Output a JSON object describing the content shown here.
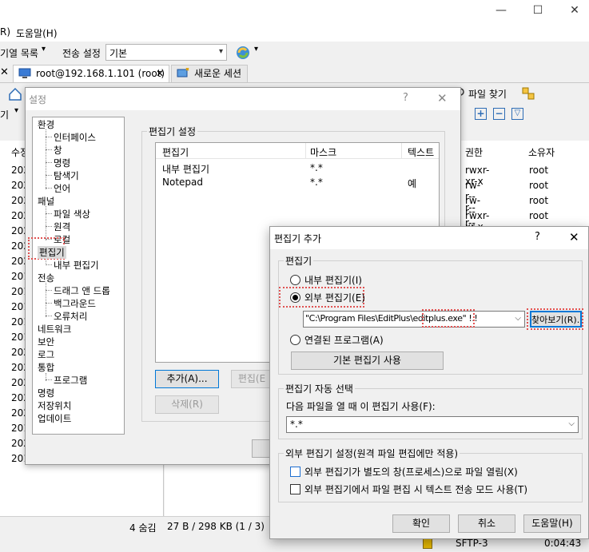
{
  "main_window": {
    "controls": {
      "minimize": "—",
      "maximize": "☐",
      "close": "✕"
    },
    "menu": {
      "partial_left": "R)",
      "help": "도움말(H)"
    },
    "toolbar": {
      "queue_dropdown": "기열 목록",
      "transfer_settings_label": "전송 설정",
      "transfer_settings_value": "기본"
    },
    "tabs": [
      {
        "label": "root@192.168.1.101 (root)",
        "close": "✕"
      },
      {
        "label": "새로운 세션"
      }
    ],
    "toolbar2": {
      "find_files": "파일 찾기",
      "partial_left": "기"
    },
    "right_columns": {
      "permissions": "권한",
      "owner": "소유자"
    },
    "left_column": {
      "modified_partial": "수정"
    },
    "files": [
      {
        "perm": "rwxr-xr-x",
        "owner": "root"
      },
      {
        "perm": "rw-r--r--",
        "owner": "root"
      },
      {
        "perm": "rw-r--r--",
        "owner": "root"
      },
      {
        "perm": "rwxr-xr-x",
        "owner": "root"
      }
    ],
    "left_dates": [
      "202",
      "202",
      "202",
      "202",
      "202",
      "202",
      "202",
      "201",
      "201",
      "201",
      "201",
      "201",
      "202",
      "202",
      "202",
      "202",
      "202",
      "201",
      "202",
      "201"
    ],
    "status": {
      "hidden": "4 숨김",
      "size": "27 B / 298 KB (1 / 3)"
    },
    "bottom": {
      "protocol": "SFTP-3",
      "time": "0:04:43"
    }
  },
  "settings_dialog": {
    "title": "설정",
    "help_icon": "?",
    "close_icon": "✕",
    "tree": [
      "환경",
      "인터페이스",
      "창",
      "명령",
      "탐색기",
      "언어",
      "패널",
      "파일 색상",
      "원격",
      "로컬",
      "편집기",
      "내부 편집기",
      "전송",
      "드래그 앤 드롭",
      "백그라운드",
      "오류처리",
      "네트워크",
      "보안",
      "로그",
      "통합",
      "프로그램",
      "명령",
      "저장위치",
      "업데이트"
    ],
    "group_title": "편집기 설정",
    "columns": {
      "editor": "편집기",
      "mask": "마스크",
      "text": "텍스트"
    },
    "rows": [
      {
        "editor": "내부 편집기",
        "mask": "*.*",
        "text": ""
      },
      {
        "editor": "Notepad",
        "mask": "*.*",
        "text": "예"
      }
    ],
    "buttons": {
      "add": "추가(A)...",
      "edit": "편집(E",
      "delete": "삭제(R)"
    }
  },
  "add_editor_dialog": {
    "title": "편집기 추가",
    "help_icon": "?",
    "close_icon": "✕",
    "editor_group": "편집기",
    "internal_option": "내부 편집기(I)",
    "external_option": "외부 편집기(E)",
    "external_path": "\"C:\\Program Files\\EditPlus\\editplus.exe\" !.!",
    "browse_button": "찾아보기(R)...",
    "associated_option": "연결된 프로그램(A)",
    "default_editor_button": "기본 편집기 사용",
    "auto_select_group": "편집기 자동 선택",
    "use_when_label": "다음 파일을 열 때 이 편집기 사용(F):",
    "mask_value": "*.*",
    "external_settings_group": "외부 편집기 설정(원격 파일 편집에만 적용)",
    "opt_separate_window": "외부 편집기가 별도의 창(프로세스)으로 파일 열림(X)",
    "opt_text_mode": "외부 편집기에서 파일 편집 시 텍스트 전송 모드 사용(T)",
    "ok": "확인",
    "cancel": "취소",
    "help": "도움말(H)"
  },
  "colors": {
    "highlight": "#e05252",
    "focus": "#0078d7",
    "window_bg": "#f0f0f0"
  }
}
